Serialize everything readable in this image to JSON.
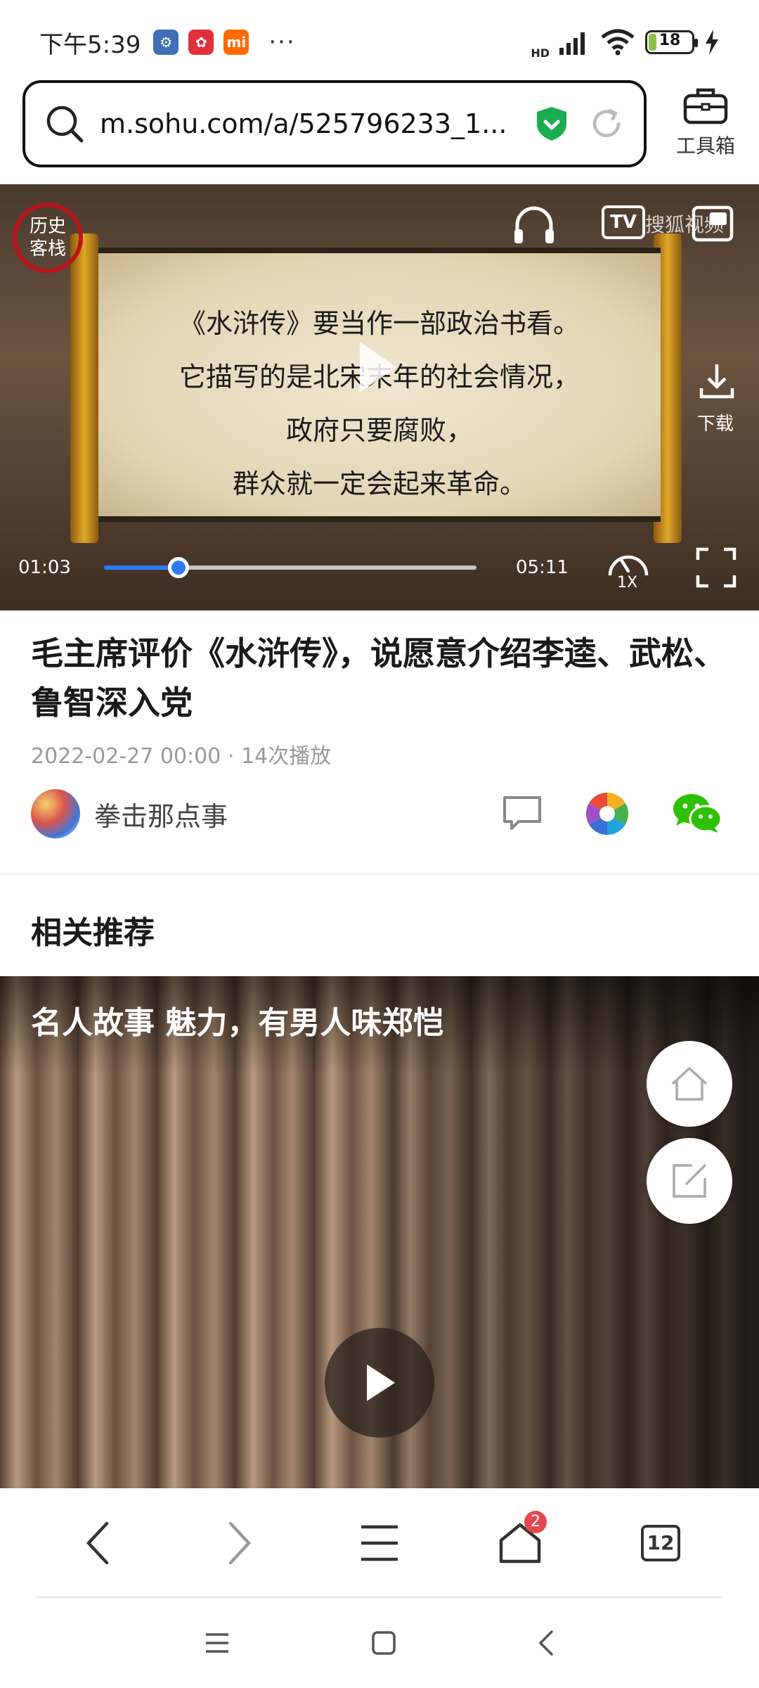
{
  "status_bar": {
    "time": "下午5:39",
    "battery": "18",
    "battery_percent": 18,
    "more": "···",
    "network": "HD"
  },
  "url_bar": {
    "url": "m.sohu.com/a/525796233_1...",
    "toolbox_label": "工具箱"
  },
  "video": {
    "current_time": "01:03",
    "total_time": "05:11",
    "progress": 0.2,
    "speed": "1X",
    "download_label": "下载",
    "tv_label": "TV",
    "brand": "搜狐视频",
    "seal_text": [
      "历史",
      "客栈"
    ],
    "caption_lines": [
      "《水浒传》要当作一部政治书看。",
      "它描写的是北宋末年的社会情况，",
      "政府只要腐败，",
      "群众就一定会起来革命。"
    ]
  },
  "article": {
    "title": "毛主席评价《水浒传》，说愿意介绍李逵、武松、鲁智深入党",
    "meta": "2022-02-27 00:00 · 14次播放",
    "author": "拳击那点事"
  },
  "related": {
    "section_title": "相关推荐",
    "items": [
      {
        "title": "名人故事 魅力，有男人味郑恺"
      }
    ]
  },
  "bottom_nav": {
    "home_badge": "2",
    "tab_count": "12"
  },
  "colors": {
    "accent": "#2b7cf6",
    "shield": "#1aad4f",
    "badge": "#e5484d",
    "wechat": "#2dc100"
  }
}
